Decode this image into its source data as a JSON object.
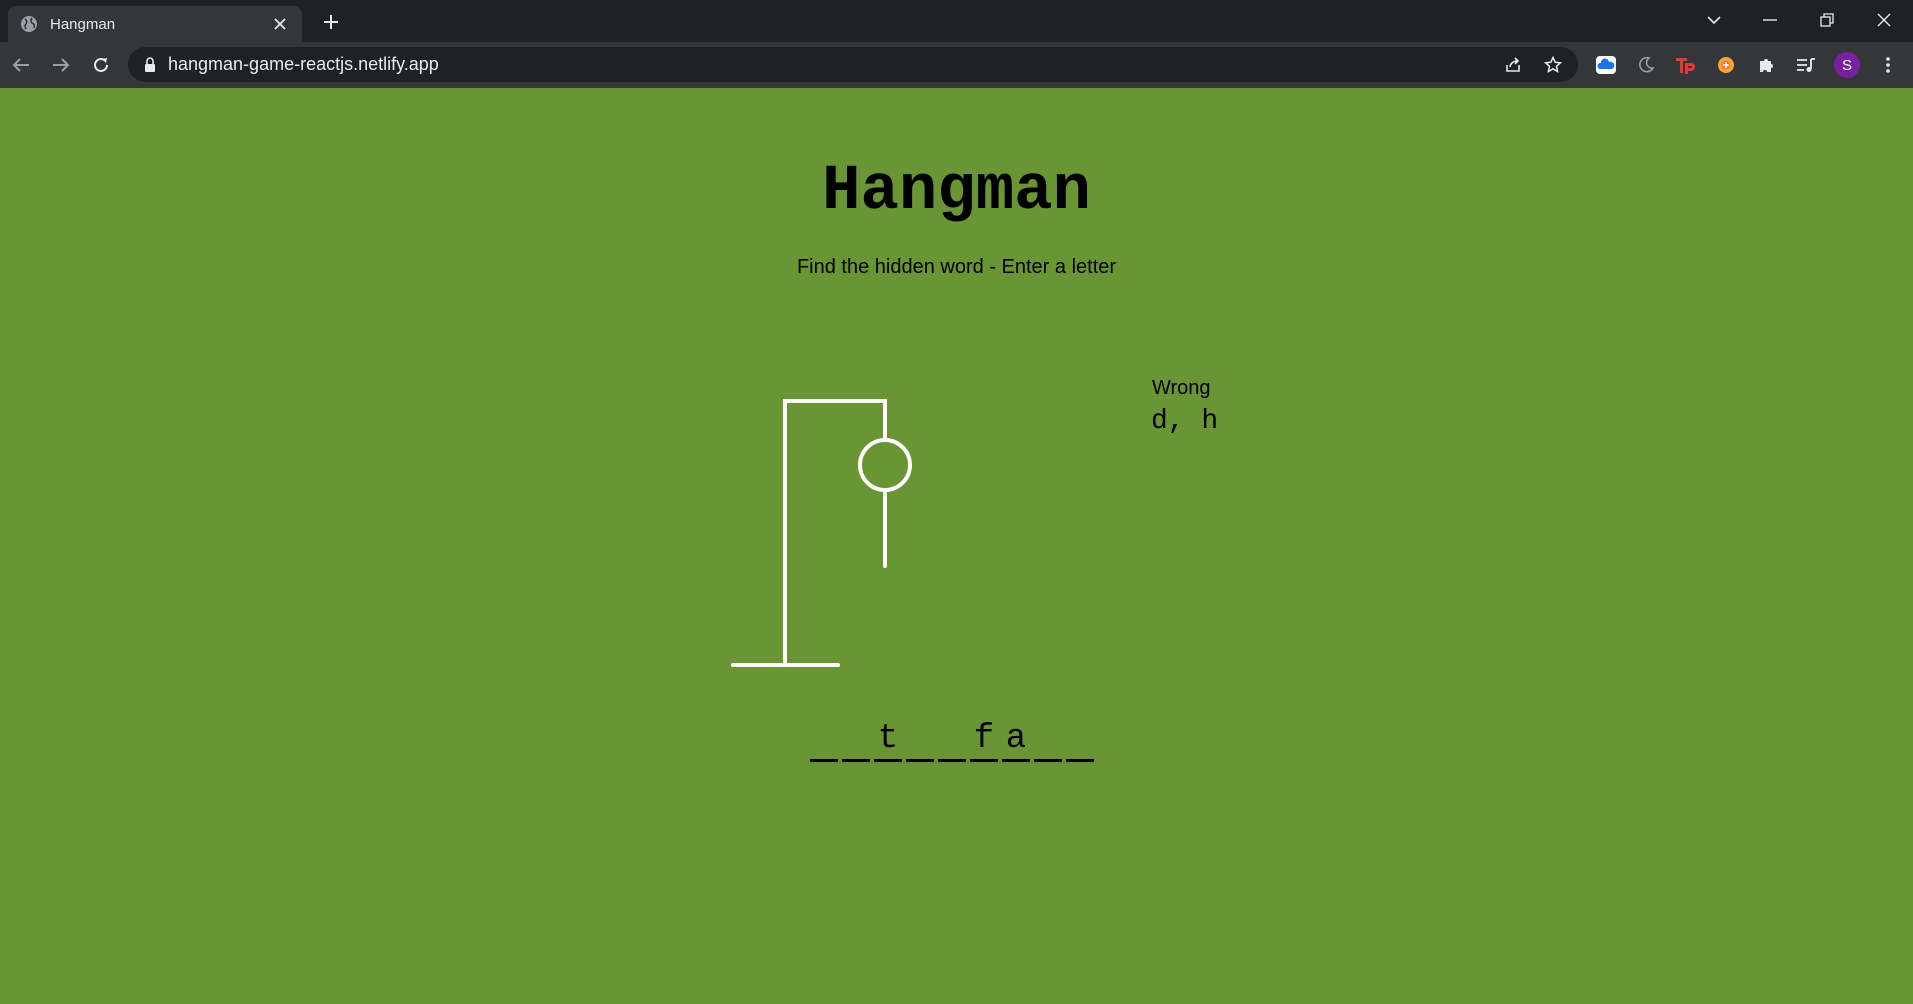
{
  "browser": {
    "tab_title": "Hangman",
    "url": "hangman-game-reactjs.netlify.app",
    "profile_initial": "S"
  },
  "page": {
    "title": "Hangman",
    "subtitle": "Find the hidden word - Enter a letter",
    "wrong_label": "Wrong",
    "wrong_letters": "d, h"
  },
  "game": {
    "word_slots": [
      "",
      "",
      "t",
      "",
      "",
      "f",
      "a",
      "",
      ""
    ],
    "wrong_guess_count": 2
  },
  "colors": {
    "page_background": "#6a9534",
    "drawing": "#ffffff",
    "text": "#000000"
  }
}
